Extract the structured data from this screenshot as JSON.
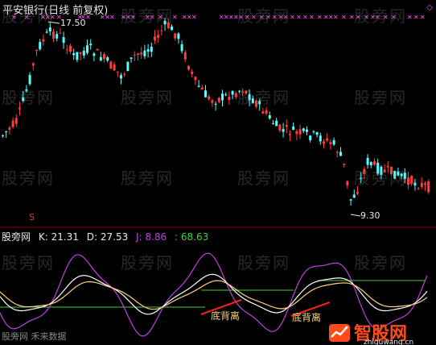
{
  "header": {
    "title": "平安银行(日线 前复权)",
    "high_label": "17.50",
    "low_label": "9.30"
  },
  "indicator": {
    "name": "股旁网",
    "k_label": "K: 21.31",
    "d_label": "D: 27.53",
    "j_label": "J: 8.86",
    "extra_label": ": 68.63"
  },
  "signals": {
    "divergence_1": "底背离",
    "divergence_2": "底背离",
    "s_mark": "S"
  },
  "watermark": "股旁网",
  "footer": {
    "bottom_left": "股旁网 禾来数据"
  },
  "logo": {
    "text": "智股网",
    "url": "zhiguwang.cn"
  },
  "colors": {
    "up": "#ff3b3b",
    "down": "#54ffff",
    "k_line": "#ffffff",
    "d_line": "#ffd27a",
    "j_line": "#c040e0",
    "ref_line": "#40d040",
    "marker": "#ff4fff"
  }
}
